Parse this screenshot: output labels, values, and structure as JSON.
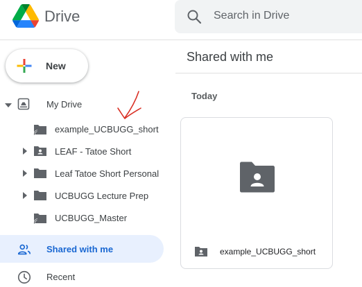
{
  "app": {
    "title": "Drive"
  },
  "search": {
    "placeholder": "Search in Drive"
  },
  "new_button": {
    "label": "New"
  },
  "sidebar": {
    "my_drive": {
      "label": "My Drive",
      "expanded": true
    },
    "folders": [
      {
        "label": "example_UCBUGG_short",
        "icon": "shortcut-folder-icon",
        "has_caret": false
      },
      {
        "label": "LEAF - Tatoe Short",
        "icon": "shared-folder-icon",
        "has_caret": true
      },
      {
        "label": "Leaf Tatoe Short Personal",
        "icon": "folder-icon",
        "has_caret": true
      },
      {
        "label": "UCBUGG Lecture Prep",
        "icon": "folder-icon",
        "has_caret": true
      },
      {
        "label": "UCBUGG_Master",
        "icon": "shortcut-folder-icon",
        "has_caret": false
      }
    ],
    "shared_with_me": {
      "label": "Shared with me",
      "active": true
    },
    "recent": {
      "label": "Recent"
    }
  },
  "main": {
    "title": "Shared with me",
    "section": "Today",
    "items": [
      {
        "name": "example_UCBUGG_short",
        "icon": "shared-folder-icon"
      }
    ]
  },
  "colors": {
    "accent_blue": "#1967d2",
    "active_bg": "#e8f0fe",
    "folder_gray": "#5f6368",
    "annotation_red": "#d93025"
  }
}
